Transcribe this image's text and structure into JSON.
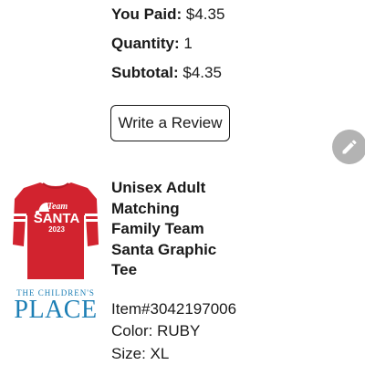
{
  "order_summary": {
    "you_paid_label": "You Paid:",
    "you_paid_value": "$4.35",
    "quantity_label": "Quantity:",
    "quantity_value": "1",
    "subtotal_label": "Subtotal:",
    "subtotal_value": "$4.35"
  },
  "review_button_label": "Write a Review",
  "edit_icon": "pencil-icon",
  "product": {
    "title": "Unisex Adult Matching Family Team Santa Graphic Tee",
    "item_number": "Item#3042197006",
    "color": "Color: RUBY",
    "size": "Size: XL",
    "image_text": {
      "line1": "Team",
      "line2": "SANTA",
      "line3": "2023"
    }
  },
  "brand": {
    "top": "THE CHILDREN'S",
    "bottom": "PLACE"
  },
  "colors": {
    "shirt_red": "#d2232f",
    "brand_blue": "#1d7fb5",
    "fab_gray": "#b3b3b3"
  }
}
